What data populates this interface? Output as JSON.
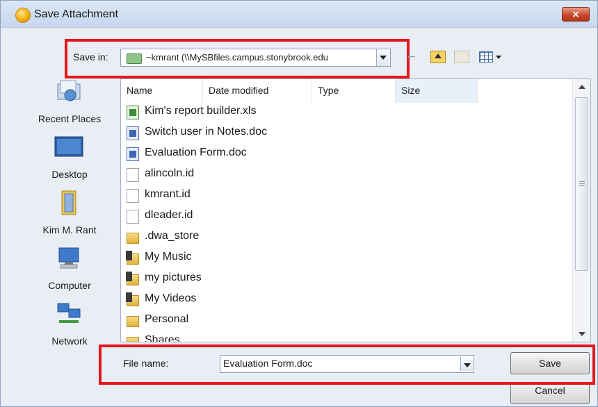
{
  "window": {
    "title": "Save Attachment",
    "close_label": "×"
  },
  "toolbar": {
    "save_in_label": "Save in:",
    "save_in_value": "~kmrant (\\\\MySBfiles.campus.stonybrook.edu",
    "icons": [
      "back-arrow-icon",
      "up-folder-icon",
      "new-folder-icon",
      "view-menu-icon"
    ]
  },
  "places": [
    {
      "label": "Recent Places",
      "icon": "recent-places-icon"
    },
    {
      "label": "Desktop",
      "icon": "desktop-icon"
    },
    {
      "label": "Kim M. Rant",
      "icon": "user-folder-icon"
    },
    {
      "label": "Computer",
      "icon": "computer-icon"
    },
    {
      "label": "Network",
      "icon": "network-icon"
    }
  ],
  "columns": [
    "Name",
    "Date modified",
    "Type",
    "Size"
  ],
  "files": [
    {
      "name": "Kim's report builder.xls",
      "kind": "xls"
    },
    {
      "name": "Switch user in Notes.doc",
      "kind": "doc"
    },
    {
      "name": "Evaluation Form.doc",
      "kind": "doc"
    },
    {
      "name": "alincoln.id",
      "kind": "id"
    },
    {
      "name": "kmrant.id",
      "kind": "id"
    },
    {
      "name": "dleader.id",
      "kind": "id"
    },
    {
      "name": ".dwa_store",
      "kind": "folder"
    },
    {
      "name": "My Music",
      "kind": "media"
    },
    {
      "name": "my pictures",
      "kind": "media"
    },
    {
      "name": "My Videos",
      "kind": "media"
    },
    {
      "name": "Personal",
      "kind": "folder"
    },
    {
      "name": "Shares",
      "kind": "folder"
    }
  ],
  "filename": {
    "label": "File name:",
    "value": "Evaluation Form.doc"
  },
  "buttons": {
    "save": "Save",
    "cancel": "Cancel"
  },
  "colors": {
    "highlight": "#e4171d",
    "window_bg": "#e9eef5"
  }
}
